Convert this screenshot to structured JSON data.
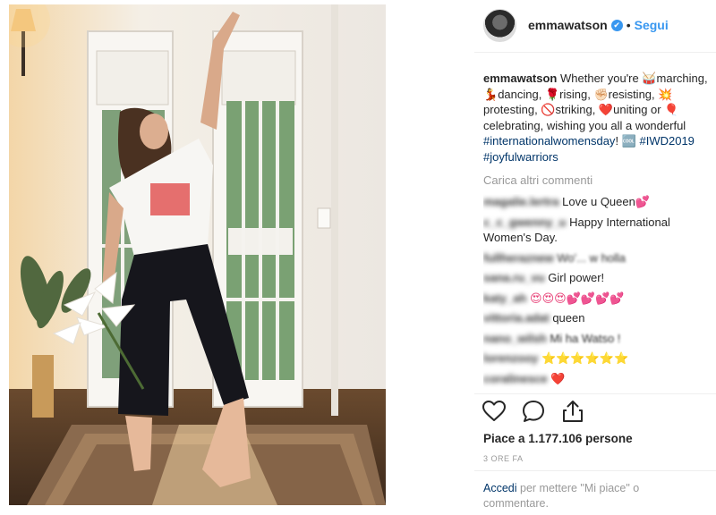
{
  "header": {
    "username": "emmawatson",
    "verified_icon": "✔",
    "separator": "•",
    "follow_label": "Segui"
  },
  "caption": {
    "username": "emmawatson",
    "text_1": "Whether you're ",
    "e_drum": "🥁",
    "t_marching": "marching, ",
    "e_dancer": "💃",
    "t_dancing": "dancing, ",
    "e_rose": "🌹",
    "t_rising": "rising, ",
    "e_fist": "✊🏻",
    "t_resisting": "resisting, ",
    "e_boom": "💥",
    "t_protesting": "protesting, ",
    "e_stop": "🚫",
    "t_striking": "striking, ",
    "e_heart": "❤️",
    "t_uniting": "uniting or ",
    "e_balloon": "🎈",
    "t_celebrating": "celebrating, wishing you all a wonderful ",
    "tag1": "#internationalwomensday",
    "t_bang": "! ",
    "e_gif": "🆒",
    "tag2": "#IWD2019",
    "tag3": "#joyfulwarriors"
  },
  "load_more_label": "Carica altri commenti",
  "comments": [
    {
      "user": "magalie.lertra",
      "text": "Love u Queen",
      "emoji": "💕"
    },
    {
      "user": "c_c_gwenny_u",
      "text": "Happy International Women's Day.",
      "emoji": ""
    },
    {
      "user": "fullheraznew",
      "text": "Wo'... w holla",
      "emoji": ""
    },
    {
      "user": "sana.ru_vu",
      "text": "Girl power!",
      "emoji": ""
    },
    {
      "user": "katy_ah",
      "text": "",
      "emoji": "😍😍😍💕💕💕💕"
    },
    {
      "user": "vittoria.adat",
      "text": "queen",
      "emoji": ""
    },
    {
      "user": "nano_wilsh",
      "text": "Mi ha Watso !",
      "emoji": ""
    },
    {
      "user": "lorenzooy",
      "text": "",
      "emoji": "⭐⭐⭐⭐⭐⭐"
    },
    {
      "user": "coralinesce",
      "text": "",
      "emoji": "❤️"
    }
  ],
  "likes_label": "Piace a 1.177.106 persone",
  "time_label": "3 ORE FA",
  "login": {
    "link": "Accedi",
    "rest": "per mettere \"Mi piace\" o commentare."
  },
  "icons": {
    "like": "heart-outline-icon",
    "comment": "speech-bubble-icon",
    "share": "share-icon"
  },
  "colors": {
    "link_blue": "#3897f0",
    "hashtag": "#003569",
    "muted": "#999999",
    "text": "#262626"
  }
}
